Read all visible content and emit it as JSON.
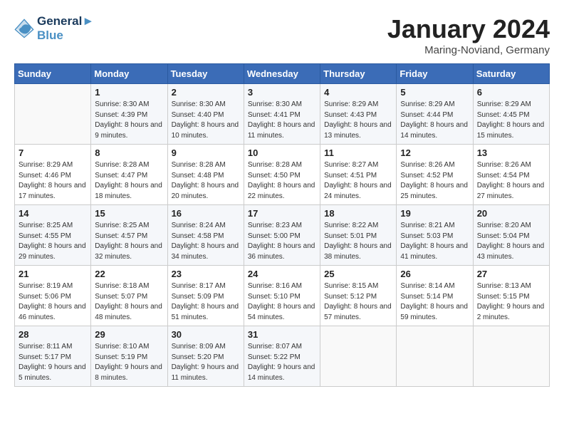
{
  "header": {
    "logo_line1": "General",
    "logo_line2": "Blue",
    "month": "January 2024",
    "location": "Maring-Noviand, Germany"
  },
  "weekdays": [
    "Sunday",
    "Monday",
    "Tuesday",
    "Wednesday",
    "Thursday",
    "Friday",
    "Saturday"
  ],
  "weeks": [
    [
      {
        "day": "",
        "sunrise": "",
        "sunset": "",
        "daylight": ""
      },
      {
        "day": "1",
        "sunrise": "8:30 AM",
        "sunset": "4:39 PM",
        "daylight": "8 hours and 9 minutes."
      },
      {
        "day": "2",
        "sunrise": "8:30 AM",
        "sunset": "4:40 PM",
        "daylight": "8 hours and 10 minutes."
      },
      {
        "day": "3",
        "sunrise": "8:30 AM",
        "sunset": "4:41 PM",
        "daylight": "8 hours and 11 minutes."
      },
      {
        "day": "4",
        "sunrise": "8:29 AM",
        "sunset": "4:43 PM",
        "daylight": "8 hours and 13 minutes."
      },
      {
        "day": "5",
        "sunrise": "8:29 AM",
        "sunset": "4:44 PM",
        "daylight": "8 hours and 14 minutes."
      },
      {
        "day": "6",
        "sunrise": "8:29 AM",
        "sunset": "4:45 PM",
        "daylight": "8 hours and 15 minutes."
      }
    ],
    [
      {
        "day": "7",
        "sunrise": "8:29 AM",
        "sunset": "4:46 PM",
        "daylight": "8 hours and 17 minutes."
      },
      {
        "day": "8",
        "sunrise": "8:28 AM",
        "sunset": "4:47 PM",
        "daylight": "8 hours and 18 minutes."
      },
      {
        "day": "9",
        "sunrise": "8:28 AM",
        "sunset": "4:48 PM",
        "daylight": "8 hours and 20 minutes."
      },
      {
        "day": "10",
        "sunrise": "8:28 AM",
        "sunset": "4:50 PM",
        "daylight": "8 hours and 22 minutes."
      },
      {
        "day": "11",
        "sunrise": "8:27 AM",
        "sunset": "4:51 PM",
        "daylight": "8 hours and 24 minutes."
      },
      {
        "day": "12",
        "sunrise": "8:26 AM",
        "sunset": "4:52 PM",
        "daylight": "8 hours and 25 minutes."
      },
      {
        "day": "13",
        "sunrise": "8:26 AM",
        "sunset": "4:54 PM",
        "daylight": "8 hours and 27 minutes."
      }
    ],
    [
      {
        "day": "14",
        "sunrise": "8:25 AM",
        "sunset": "4:55 PM",
        "daylight": "8 hours and 29 minutes."
      },
      {
        "day": "15",
        "sunrise": "8:25 AM",
        "sunset": "4:57 PM",
        "daylight": "8 hours and 32 minutes."
      },
      {
        "day": "16",
        "sunrise": "8:24 AM",
        "sunset": "4:58 PM",
        "daylight": "8 hours and 34 minutes."
      },
      {
        "day": "17",
        "sunrise": "8:23 AM",
        "sunset": "5:00 PM",
        "daylight": "8 hours and 36 minutes."
      },
      {
        "day": "18",
        "sunrise": "8:22 AM",
        "sunset": "5:01 PM",
        "daylight": "8 hours and 38 minutes."
      },
      {
        "day": "19",
        "sunrise": "8:21 AM",
        "sunset": "5:03 PM",
        "daylight": "8 hours and 41 minutes."
      },
      {
        "day": "20",
        "sunrise": "8:20 AM",
        "sunset": "5:04 PM",
        "daylight": "8 hours and 43 minutes."
      }
    ],
    [
      {
        "day": "21",
        "sunrise": "8:19 AM",
        "sunset": "5:06 PM",
        "daylight": "8 hours and 46 minutes."
      },
      {
        "day": "22",
        "sunrise": "8:18 AM",
        "sunset": "5:07 PM",
        "daylight": "8 hours and 48 minutes."
      },
      {
        "day": "23",
        "sunrise": "8:17 AM",
        "sunset": "5:09 PM",
        "daylight": "8 hours and 51 minutes."
      },
      {
        "day": "24",
        "sunrise": "8:16 AM",
        "sunset": "5:10 PM",
        "daylight": "8 hours and 54 minutes."
      },
      {
        "day": "25",
        "sunrise": "8:15 AM",
        "sunset": "5:12 PM",
        "daylight": "8 hours and 57 minutes."
      },
      {
        "day": "26",
        "sunrise": "8:14 AM",
        "sunset": "5:14 PM",
        "daylight": "8 hours and 59 minutes."
      },
      {
        "day": "27",
        "sunrise": "8:13 AM",
        "sunset": "5:15 PM",
        "daylight": "9 hours and 2 minutes."
      }
    ],
    [
      {
        "day": "28",
        "sunrise": "8:11 AM",
        "sunset": "5:17 PM",
        "daylight": "9 hours and 5 minutes."
      },
      {
        "day": "29",
        "sunrise": "8:10 AM",
        "sunset": "5:19 PM",
        "daylight": "9 hours and 8 minutes."
      },
      {
        "day": "30",
        "sunrise": "8:09 AM",
        "sunset": "5:20 PM",
        "daylight": "9 hours and 11 minutes."
      },
      {
        "day": "31",
        "sunrise": "8:07 AM",
        "sunset": "5:22 PM",
        "daylight": "9 hours and 14 minutes."
      },
      {
        "day": "",
        "sunrise": "",
        "sunset": "",
        "daylight": ""
      },
      {
        "day": "",
        "sunrise": "",
        "sunset": "",
        "daylight": ""
      },
      {
        "day": "",
        "sunrise": "",
        "sunset": "",
        "daylight": ""
      }
    ]
  ],
  "labels": {
    "sunrise_prefix": "Sunrise: ",
    "sunset_prefix": "Sunset: ",
    "daylight_prefix": "Daylight: "
  }
}
